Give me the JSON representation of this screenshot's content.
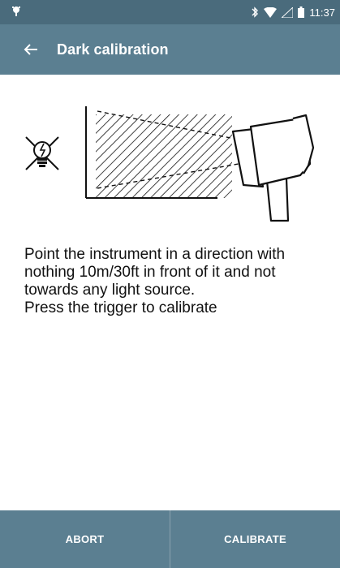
{
  "status_bar": {
    "time": "11:37",
    "icons": [
      "notification-icon",
      "bluetooth-icon",
      "wifi-icon",
      "signal-icon",
      "battery-icon"
    ]
  },
  "app_bar": {
    "title": "Dark calibration",
    "back_icon": "arrow-left-icon"
  },
  "illustration": {
    "icons": [
      "no-light-bulb-icon",
      "hatched-target-area",
      "instrument-icon"
    ]
  },
  "instructions": {
    "line1": "Point the instrument in a direction with nothing 10m/30ft in front of it and not towards any light source.",
    "line2": "Press the trigger to calibrate"
  },
  "bottom_bar": {
    "abort_label": "ABORT",
    "calibrate_label": "CALIBRATE"
  },
  "colors": {
    "status_bar": "#4a6b7c",
    "app_bar": "#5b7f91",
    "bottom_bar": "#5b7f91"
  }
}
